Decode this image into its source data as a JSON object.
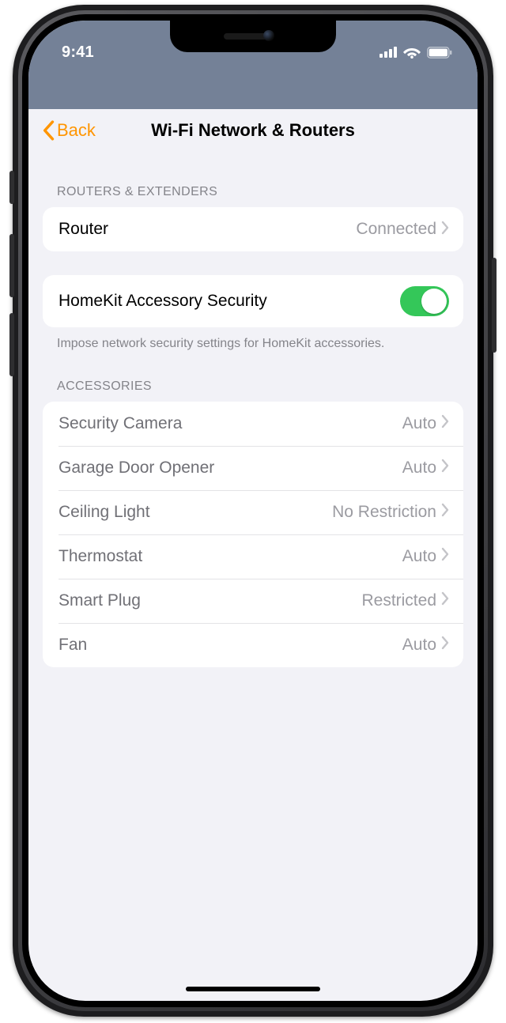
{
  "status": {
    "time": "9:41"
  },
  "nav": {
    "back_label": "Back",
    "title": "Wi-Fi Network & Routers"
  },
  "sections": {
    "routers_header": "ROUTERS & EXTENDERS",
    "accessories_header": "ACCESSORIES",
    "security_footer": "Impose network security settings for HomeKit accessories."
  },
  "router_row": {
    "label": "Router",
    "value": "Connected"
  },
  "security_toggle": {
    "label": "HomeKit Accessory Security",
    "on": true
  },
  "accessories": [
    {
      "label": "Security Camera",
      "value": "Auto"
    },
    {
      "label": "Garage Door Opener",
      "value": "Auto"
    },
    {
      "label": "Ceiling Light",
      "value": "No Restriction"
    },
    {
      "label": "Thermostat",
      "value": "Auto"
    },
    {
      "label": "Smart Plug",
      "value": "Restricted"
    },
    {
      "label": "Fan",
      "value": "Auto"
    }
  ],
  "colors": {
    "tint": "#ff9500",
    "toggle_on": "#34c759",
    "statusbar_bg": "#748197",
    "page_bg": "#f2f2f7"
  }
}
